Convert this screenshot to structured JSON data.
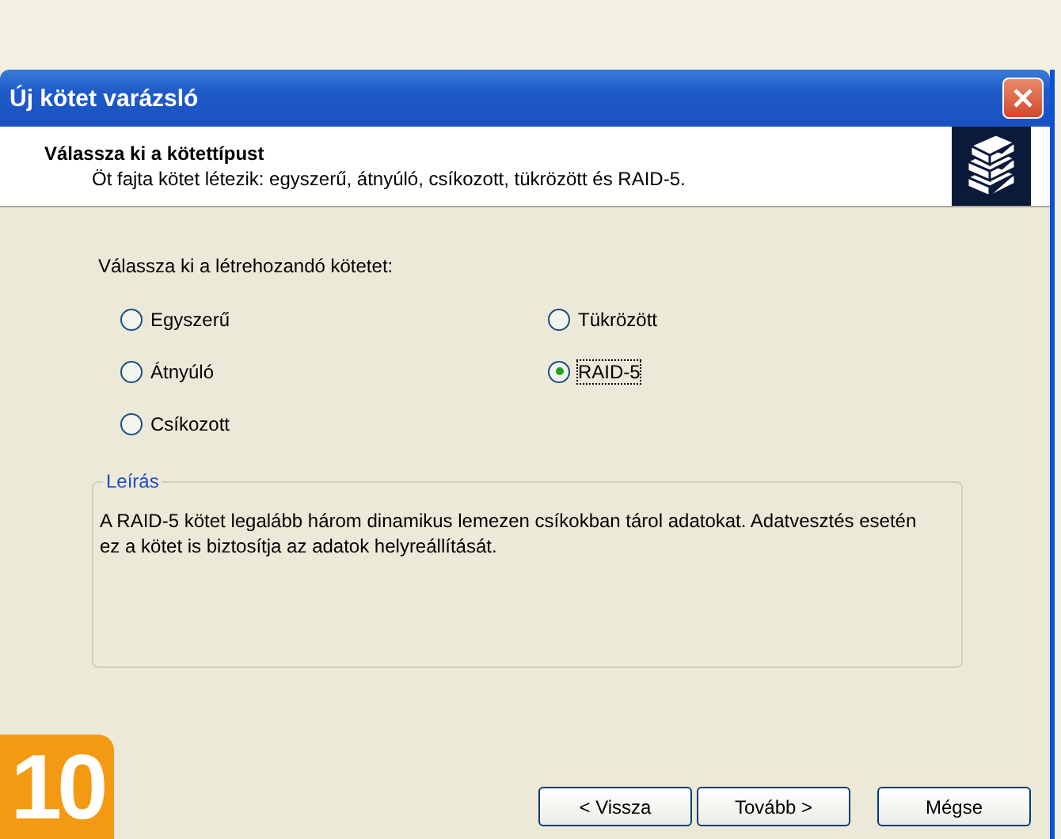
{
  "window": {
    "title": "Új kötet varázsló"
  },
  "header": {
    "title": "Válassza ki a kötettípust",
    "subtitle": "Öt fajta kötet létezik: egyszerű, átnyúló, csíkozott, tükrözött és RAID-5."
  },
  "prompt": "Válassza ki a létrehozandó kötetet:",
  "options": [
    {
      "label": "Egyszerű",
      "selected": false
    },
    {
      "label": "Átnyúló",
      "selected": false
    },
    {
      "label": "Csíkozott",
      "selected": false
    },
    {
      "label": "Tükrözött",
      "selected": false
    },
    {
      "label": "RAID-5",
      "selected": true
    }
  ],
  "description": {
    "title": "Leírás",
    "text": "A RAID-5 kötet legalább három dinamikus lemezen csíkokban tárol adatokat. Adatvesztés esetén ez a kötet is biztosítja az adatok helyreállítását."
  },
  "buttons": [
    {
      "label": "< Vissza"
    },
    {
      "label": "Tovább >"
    },
    {
      "label": "Mégse"
    }
  ],
  "step_badge": "10"
}
